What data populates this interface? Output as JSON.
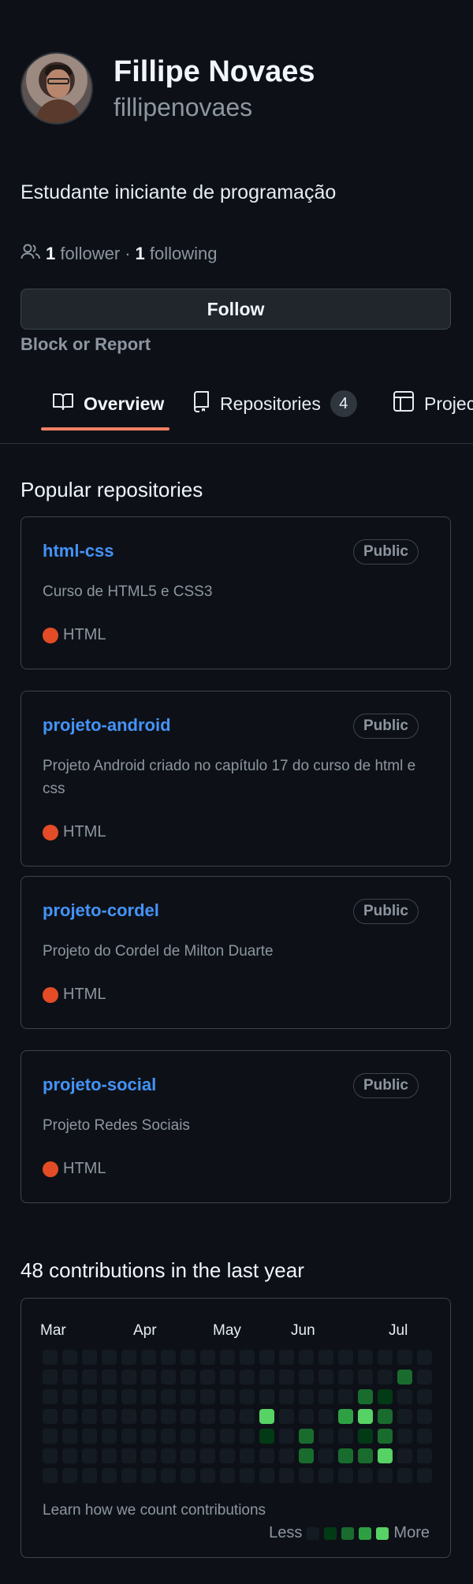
{
  "profile": {
    "name": "Fillipe Novaes",
    "username": "fillipenovaes",
    "bio": "Estudante iniciante de programação",
    "followers_count": "1",
    "followers_label": "follower",
    "separator": "·",
    "following_count": "1",
    "following_label": "following",
    "follow_button": "Follow",
    "block_report": "Block or Report"
  },
  "tabs": [
    {
      "label": "Overview",
      "icon": "book-icon",
      "active": true
    },
    {
      "label": "Repositories",
      "icon": "repo-icon",
      "count": "4"
    },
    {
      "label": "Projects",
      "icon": "table-icon"
    }
  ],
  "popular": {
    "title": "Popular repositories",
    "repos": [
      {
        "name": "html-css",
        "visibility": "Public",
        "description": "Curso de HTML5 e CSS3",
        "language": "HTML"
      },
      {
        "name": "projeto-android",
        "visibility": "Public",
        "description": "Projeto Android criado no capítulo 17 do curso de html e css",
        "language": "HTML"
      },
      {
        "name": "projeto-cordel",
        "visibility": "Public",
        "description": "Projeto do Cordel de Milton Duarte",
        "language": "HTML"
      },
      {
        "name": "projeto-social",
        "visibility": "Public",
        "description": "Projeto Redes Sociais",
        "language": "HTML"
      }
    ],
    "language_color": "#e34c26"
  },
  "contributions": {
    "title": "48 contributions in the last year",
    "months": [
      "Mar",
      "Apr",
      "May",
      "Jun",
      "Jul"
    ],
    "weeks": 20,
    "levels_by_week": [
      [
        0,
        0,
        0,
        0,
        0,
        0,
        0
      ],
      [
        0,
        0,
        0,
        0,
        0,
        0,
        0
      ],
      [
        0,
        0,
        0,
        0,
        0,
        0,
        0
      ],
      [
        0,
        0,
        0,
        0,
        0,
        0,
        0
      ],
      [
        0,
        0,
        0,
        0,
        0,
        0,
        0
      ],
      [
        0,
        0,
        0,
        0,
        0,
        0,
        0
      ],
      [
        0,
        0,
        0,
        0,
        0,
        0,
        0
      ],
      [
        0,
        0,
        0,
        0,
        0,
        0,
        0
      ],
      [
        0,
        0,
        0,
        0,
        0,
        0,
        0
      ],
      [
        0,
        0,
        0,
        0,
        0,
        0,
        0
      ],
      [
        0,
        0,
        0,
        0,
        0,
        0,
        0
      ],
      [
        0,
        0,
        0,
        4,
        1,
        0,
        0
      ],
      [
        0,
        0,
        0,
        0,
        0,
        0,
        0
      ],
      [
        0,
        0,
        0,
        0,
        2,
        2,
        0
      ],
      [
        0,
        0,
        0,
        0,
        0,
        0,
        0
      ],
      [
        0,
        0,
        0,
        3,
        0,
        2,
        0
      ],
      [
        0,
        0,
        2,
        4,
        1,
        2,
        0
      ],
      [
        0,
        0,
        1,
        2,
        2,
        4,
        0
      ],
      [
        0,
        2,
        0,
        0,
        0,
        0,
        0
      ],
      [
        0,
        0,
        0,
        0,
        0,
        0,
        0
      ]
    ],
    "learn_link": "Learn how we count contributions",
    "legend_less": "Less",
    "legend_more": "More",
    "level_colors": [
      "#151b23",
      "#033a16",
      "#196c2e",
      "#2ea043",
      "#56d364"
    ]
  }
}
